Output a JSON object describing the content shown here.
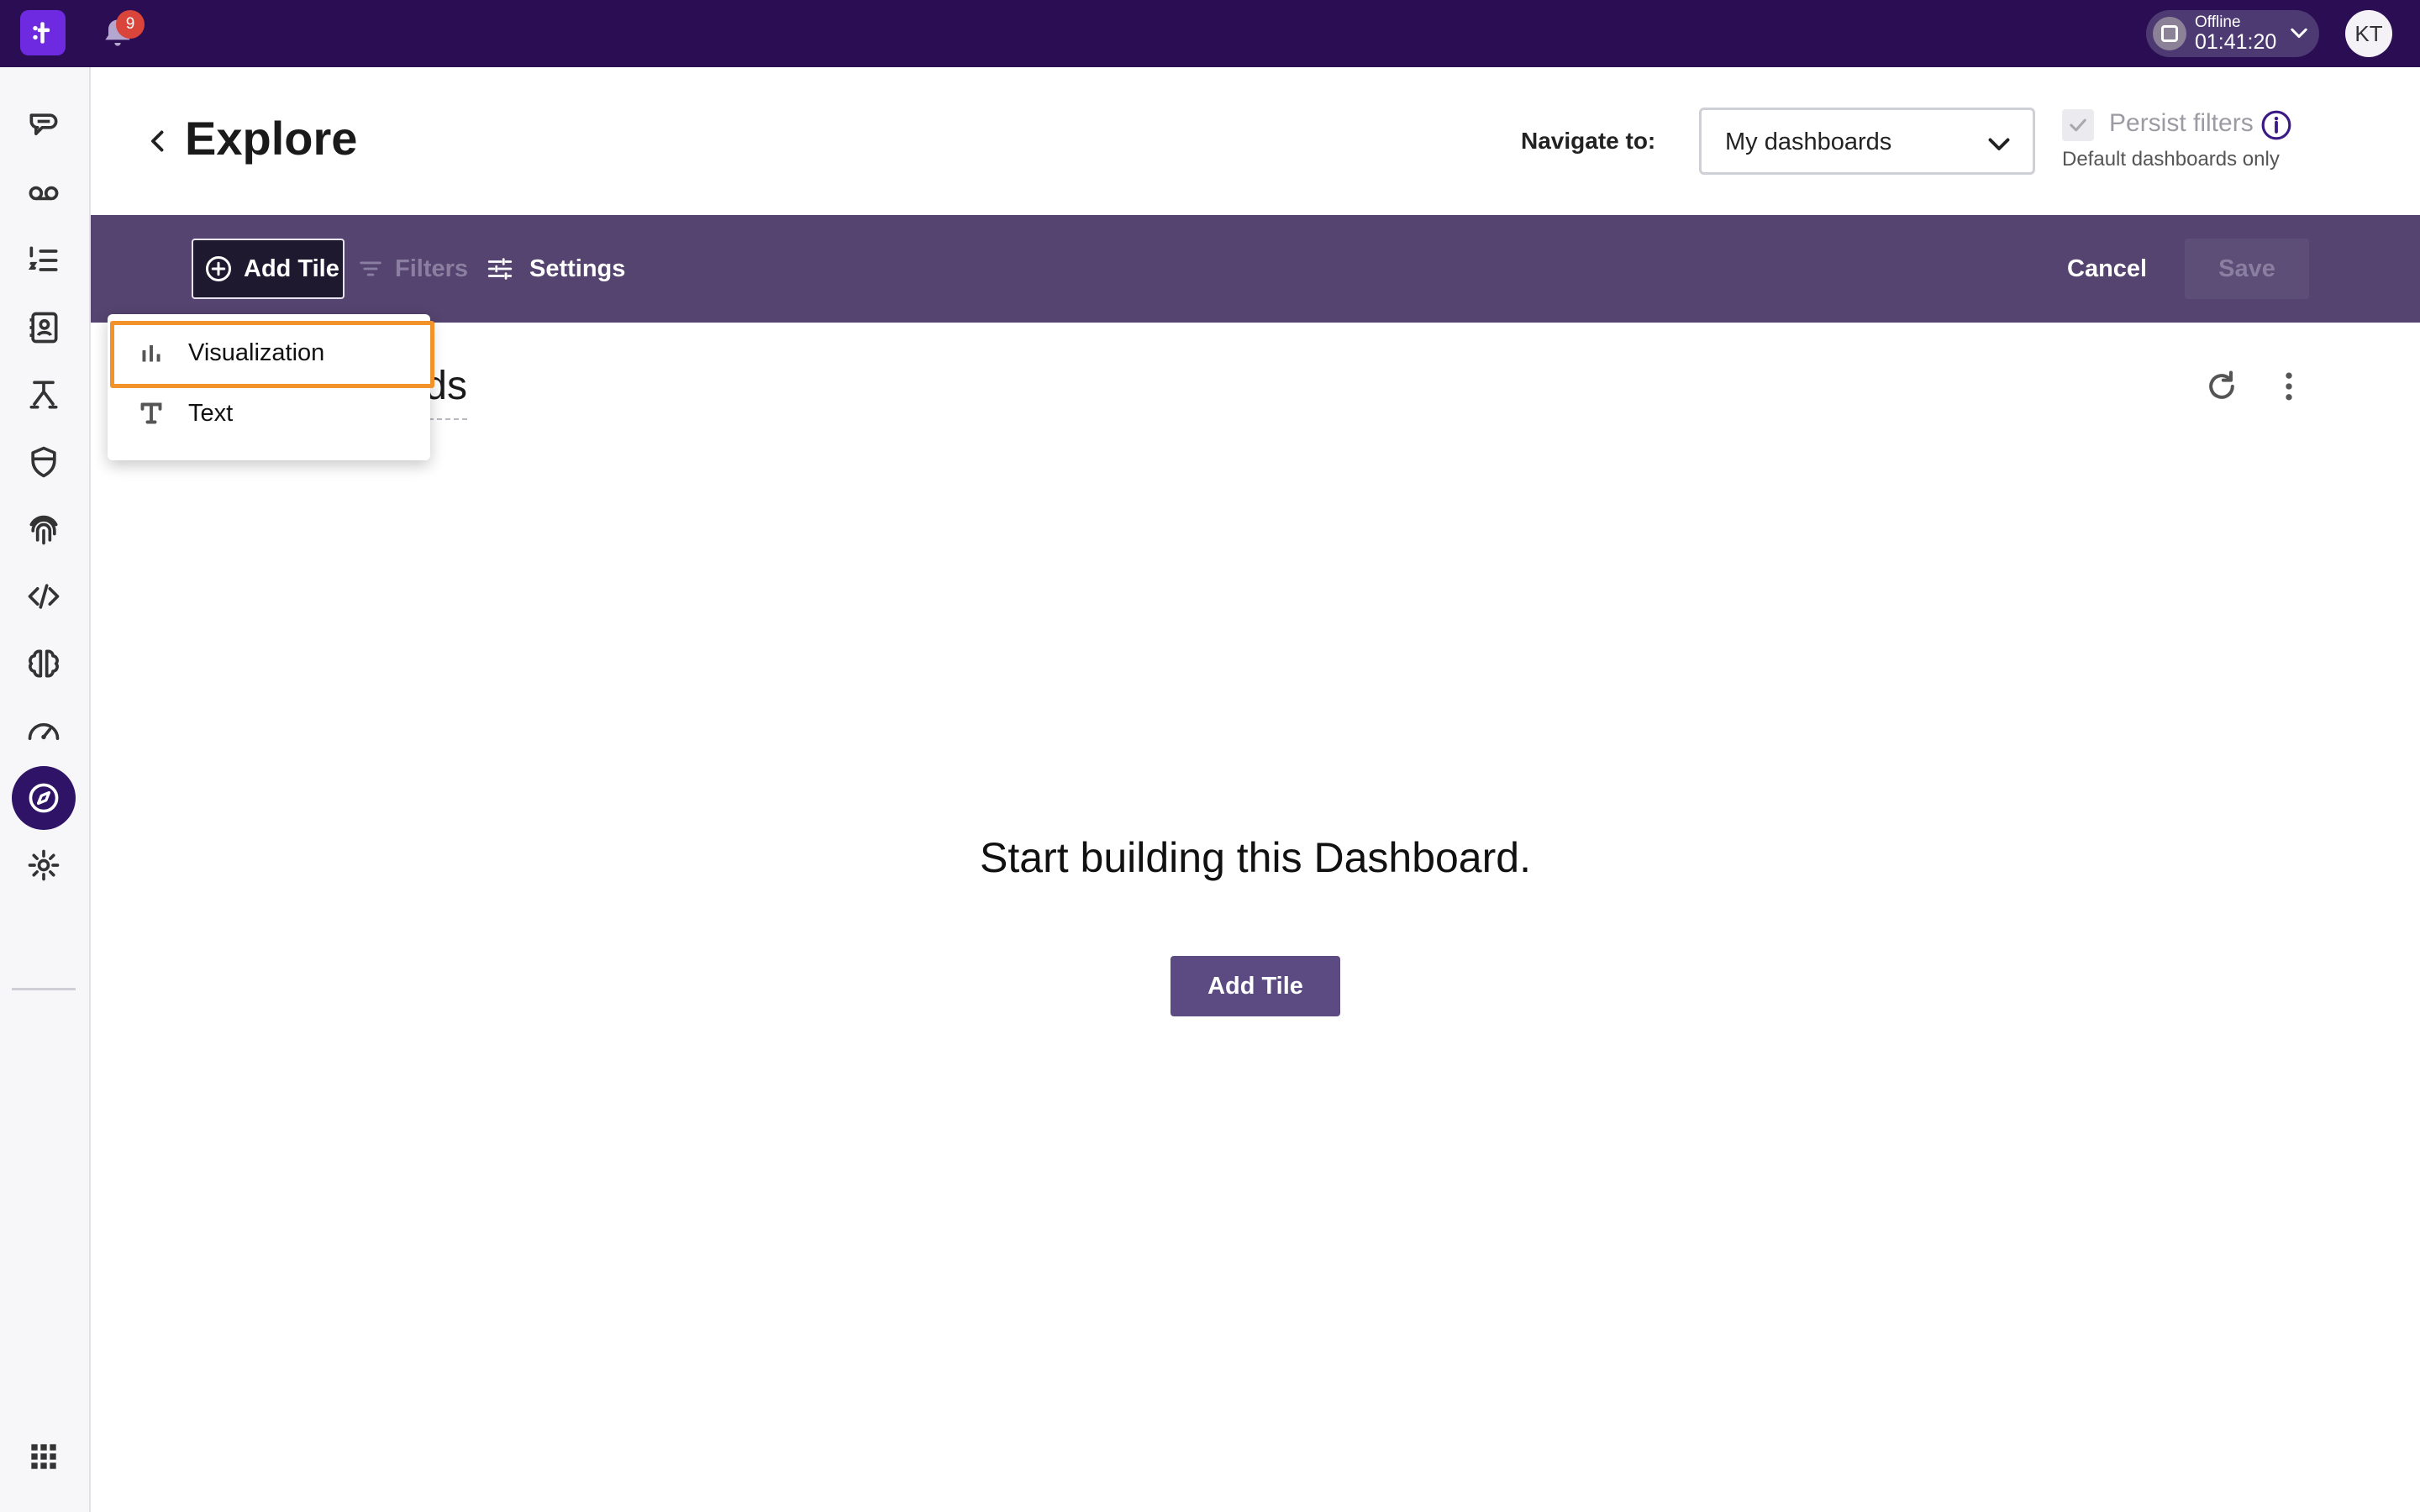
{
  "topbar": {
    "logo_text": "t",
    "notifications_count": "9",
    "status_label": "Offline",
    "status_time": "01:41:20",
    "avatar_initials": "KT"
  },
  "sidebar": {
    "items": [
      {
        "icon": "chat-bubble-icon"
      },
      {
        "icon": "voicemail-icon"
      },
      {
        "icon": "list-numbered-icon"
      },
      {
        "icon": "contacts-book-icon"
      },
      {
        "icon": "flow-routing-icon"
      },
      {
        "icon": "shield-icon"
      },
      {
        "icon": "fingerprint-icon"
      },
      {
        "icon": "code-icon"
      },
      {
        "icon": "ai-brain-icon"
      },
      {
        "icon": "speedometer-icon"
      },
      {
        "icon": "compass-icon",
        "active": true
      },
      {
        "icon": "settings-gear-icon"
      }
    ],
    "bottom_icon": "apps-grid-icon"
  },
  "header": {
    "title": "Explore",
    "navigate_label": "Navigate to:",
    "navigate_value": "My dashboards",
    "persist_filters_label": "Persist filters",
    "persist_filters_sub": "Default dashboards only"
  },
  "toolbar": {
    "add_tile_label": "Add Tile",
    "filters_label": "Filters",
    "settings_label": "Settings",
    "cancel_label": "Cancel",
    "save_label": "Save"
  },
  "dashboard": {
    "title_visible_fragment": "ds",
    "empty_message": "Start building this Dashboard.",
    "add_tile_label": "Add Tile"
  },
  "add_tile_menu": {
    "items": [
      {
        "label": "Visualization",
        "icon": "bar-chart-icon",
        "highlighted": true
      },
      {
        "label": "Text",
        "icon": "text-format-icon"
      }
    ]
  },
  "colors": {
    "topbar_bg": "#2a0d52",
    "toolbar_bg": "#54446f",
    "accent_purple": "#6d2ae0",
    "highlight_orange": "#f2922a",
    "primary_button": "#5c4b82"
  }
}
